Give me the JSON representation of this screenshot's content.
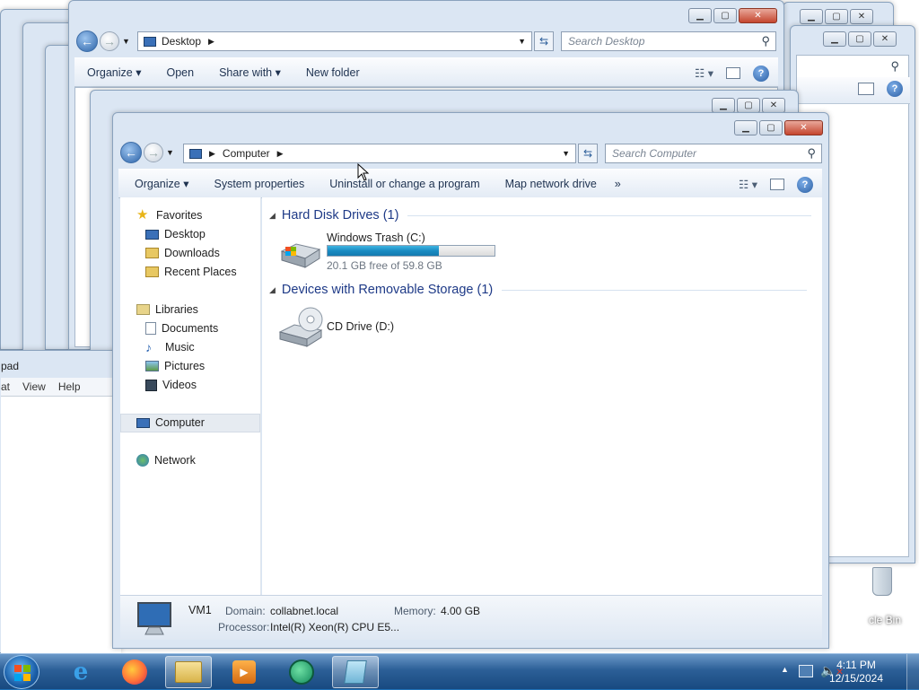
{
  "back_windows": {
    "desktop_window": {
      "address": "Desktop",
      "search_placeholder": "Search Desktop",
      "toolbar": [
        "Organize ▾",
        "Open",
        "Share with ▾",
        "New folder"
      ]
    },
    "notepad_partial": {
      "title": "pad",
      "menu": [
        "at",
        "View",
        "Help"
      ]
    },
    "desktop_icon_label": "cle Bin"
  },
  "explorer": {
    "address_root": "Computer",
    "search_placeholder": "Search Computer",
    "toolbar": {
      "organize": "Organize",
      "system_properties": "System properties",
      "uninstall": "Uninstall or change a program",
      "map_drive": "Map network drive",
      "more": "»"
    },
    "sidebar": {
      "favorites": "Favorites",
      "favorites_items": [
        "Desktop",
        "Downloads",
        "Recent Places"
      ],
      "libraries": "Libraries",
      "libraries_items": [
        "Documents",
        "Music",
        "Pictures",
        "Videos"
      ],
      "computer": "Computer",
      "network": "Network"
    },
    "groups": {
      "hdd": "Hard Disk Drives (1)",
      "removable": "Devices with Removable Storage (1)"
    },
    "drives": {
      "c": {
        "name": "Windows Trash (C:)",
        "free_text": "20.1 GB free of 59.8 GB",
        "used_fraction": 0.664
      },
      "d": {
        "name": "CD Drive (D:)"
      }
    },
    "status": {
      "name": "VM1",
      "domain_label": "Domain:",
      "domain": "collabnet.local",
      "memory_label": "Memory:",
      "memory": "4.00 GB",
      "processor_label": "Processor:",
      "processor": "Intel(R) Xeon(R) CPU E5..."
    }
  },
  "taskbar": {
    "time": "4:11 PM",
    "date": "12/15/2024"
  },
  "colors": {
    "taskbar": "#2c5f97",
    "group_header": "#1e3a87",
    "progress": "#1a8bc2"
  }
}
